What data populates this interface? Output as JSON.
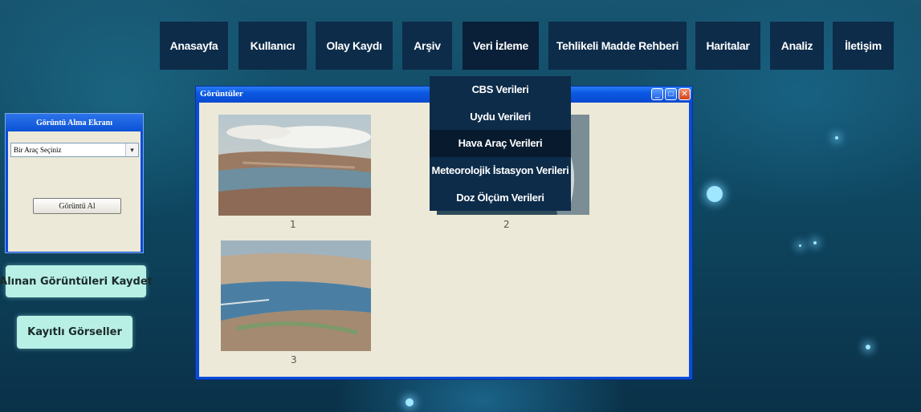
{
  "nav": {
    "items": [
      {
        "label": "Anasayfa"
      },
      {
        "label": "Kullanıcı"
      },
      {
        "label": "Olay Kaydı"
      },
      {
        "label": "Arşiv"
      },
      {
        "label": "Veri İzleme"
      },
      {
        "label": "Tehlikeli Madde Rehberi"
      },
      {
        "label": "Haritalar"
      },
      {
        "label": "Analiz"
      },
      {
        "label": "İletişim"
      }
    ],
    "active": "Veri İzleme"
  },
  "dropdown": {
    "items": [
      {
        "label": "CBS Verileri"
      },
      {
        "label": "Uydu Verileri"
      },
      {
        "label": "Hava Araç Verileri"
      },
      {
        "label": "Meteorolojik İstasyon Verileri"
      },
      {
        "label": "Doz Ölçüm Verileri"
      }
    ],
    "hovered": "Hava Araç Verileri"
  },
  "images_window": {
    "title": "Görüntüler",
    "thumbnails": [
      {
        "label": "1"
      },
      {
        "label": "2"
      },
      {
        "label": "3"
      }
    ]
  },
  "capture_panel": {
    "title": "Görüntü Alma Ekranı",
    "select_value": "Bir Araç Seçiniz",
    "capture_button": "Görüntü Al"
  },
  "actions": {
    "save_images": "Alınan Görüntüleri Kaydet",
    "saved_images": "Kayıtlı Görseller"
  },
  "colors": {
    "nav_bg": "#0d2c4a",
    "button_bg": "#b9f0e6",
    "window_blue": "#0a4bd8",
    "window_body": "#ece9d8"
  }
}
